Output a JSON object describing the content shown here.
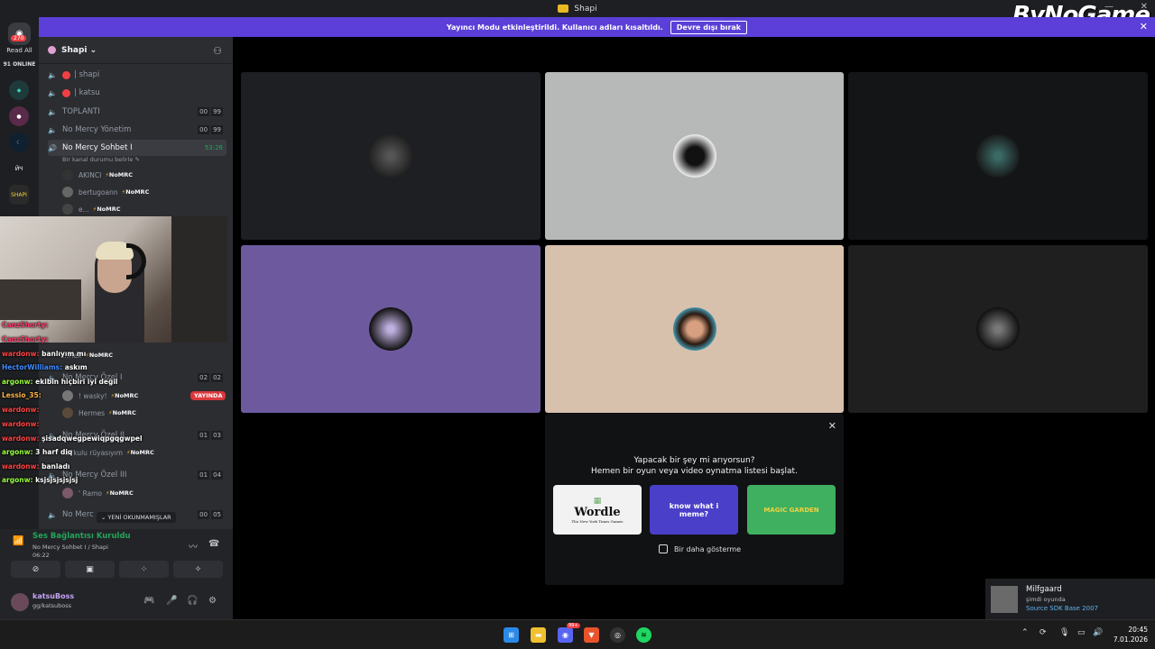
{
  "window": {
    "title": "Shapi"
  },
  "logo": {
    "text": "ByNoGame"
  },
  "banner": {
    "text": "Yayıncı Modu etkinleştirildi. Kullanıcı adları kısaltıldı.",
    "button": "Devre dışı bırak"
  },
  "rail": {
    "badge": "270",
    "read_all": "Read All",
    "online": "91 ONLINE",
    "server_label": "SHAPI"
  },
  "server": {
    "name": "Shapi ⌄"
  },
  "channels": [
    {
      "name": "| shapi"
    },
    {
      "name": "| katsu"
    },
    {
      "name": "TOPLANTI",
      "a": "00",
      "b": "99"
    },
    {
      "name": "No Mercy Yönetim",
      "a": "00",
      "b": "99"
    },
    {
      "name": "No Mercy Sohbet I",
      "timer": "53:26"
    }
  ],
  "channel_status": "Bir kanal durumu belirle ✎",
  "members": [
    {
      "name": "AKINCI",
      "tag": "NoMRC"
    },
    {
      "name": "bertugoann",
      "tag": "NoMRC"
    },
    {
      "name": "e...",
      "tag": "NoMRC"
    }
  ],
  "lower_channels": [
    {
      "name": "No Mercy Özel I",
      "a": "02",
      "b": "02"
    },
    {
      "name": "No Mercy Özel II",
      "a": "01",
      "b": "03"
    },
    {
      "name": "No Mercy Özel III",
      "a": "01",
      "b": "04"
    },
    {
      "name": "No Merc",
      "a": "00",
      "b": "05"
    }
  ],
  "lower_members": [
    {
      "name": "...rlex",
      "tag": "NoMRC"
    },
    {
      "name": "! wasky!",
      "tag": "NoMRC"
    },
    {
      "name": "Hermes",
      "tag": "NoMRC"
    },
    {
      "name": "Korkulu rüyasıyım",
      "tag": "NoMRC"
    },
    {
      "name": "' Ramo",
      "tag": "NoMRC"
    }
  ],
  "live_badge": "YAYINDA",
  "chat": [
    {
      "user": "CanzShorty:",
      "msg": "",
      "color": "#ff3d6a"
    },
    {
      "user": "CanzShorty:",
      "msg": "",
      "color": "#ff3d6a"
    },
    {
      "user": "wardonw:",
      "msg": " banlıyım mı",
      "color": "#ff4444"
    },
    {
      "user": "HectorWilliams:",
      "msg": " askım",
      "color": "#3f8cff"
    },
    {
      "user": "argonw:",
      "msg": " ekibin hiçbiri iyi değil",
      "color": "#9aff3f"
    },
    {
      "user": "Lessio_35:",
      "msg": "",
      "color": "#ffb347"
    },
    {
      "user": "wardonw:",
      "msg": "",
      "color": "#ff4444"
    },
    {
      "user": "wardonw:",
      "msg": "",
      "color": "#ff4444"
    },
    {
      "user": "wardonw:",
      "msg": " şisadqwegpewiqpgqgwpel",
      "color": "#ff4444"
    },
    {
      "user": "argonw:",
      "msg": " 3 harf diq",
      "color": "#9aff3f"
    },
    {
      "user": "wardonw:",
      "msg": " banladı",
      "color": "#ff4444"
    },
    {
      "user": "argonw:",
      "msg": " ksjsjsjsjsjsj",
      "color": "#9aff3f"
    }
  ],
  "new_messages": "⌄ YENİ OKUNMAMIŞLAR",
  "voice": {
    "status": "Ses Bağlantısı Kuruldu",
    "channel": "No Mercy Sohbet I / Shapi",
    "time": "06:22"
  },
  "user": {
    "name": "katsuBoss",
    "sub": "gg/katsuboss"
  },
  "activity": {
    "title_line1": "Yapacak bir şey mi arıyorsun?",
    "title_line2": "Hemen bir oyun veya video oynatma listesi başlat.",
    "card1": "Wordle",
    "card1_sub": "The New York Times Games",
    "card2": "know what i meme?",
    "card3": "MAGIC GARDEN",
    "checkbox": "Bir daha gösterme"
  },
  "game_toast": {
    "name": "Milfgaard",
    "sub": "şimdi oyunda",
    "app": "Source SDK Base 2007"
  },
  "taskbar": {
    "time": "20:45",
    "date": "7.01.2026",
    "discord_badge": "99+"
  },
  "tile_colors": [
    "#1e1f22",
    "#b7b9b8",
    "#141516",
    "#6d5a9e",
    "#d7c1ad",
    "#1f1f1f"
  ]
}
